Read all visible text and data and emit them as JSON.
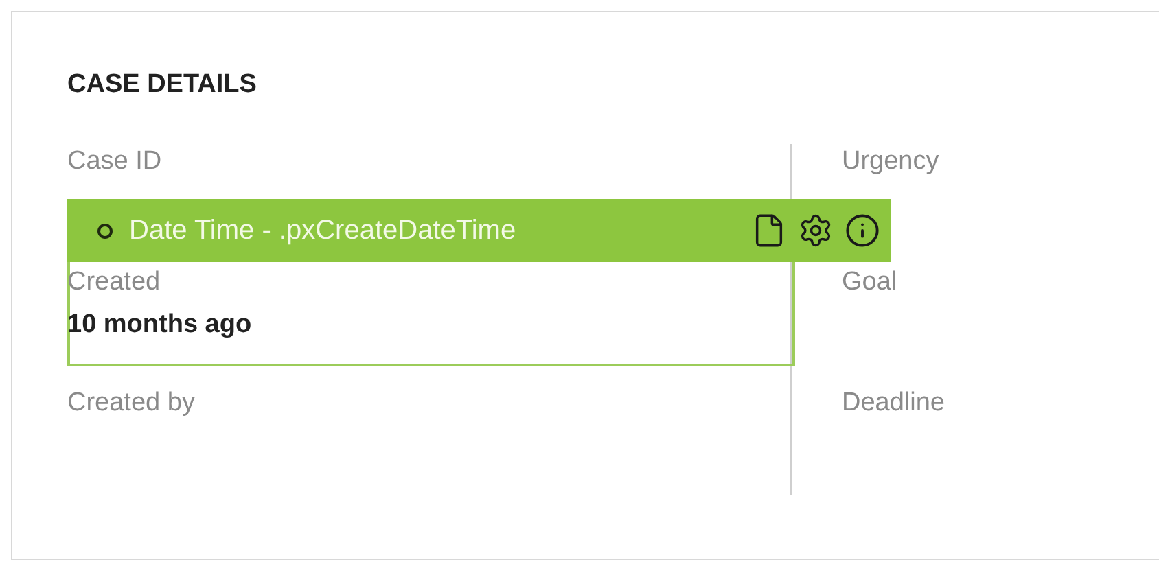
{
  "section": {
    "title": "CASE DETAILS"
  },
  "left_fields": [
    {
      "label": "Case ID",
      "selected": false
    },
    {
      "label": "Created",
      "value": "10 months ago",
      "selected": true
    },
    {
      "label": "Created by",
      "selected": false
    }
  ],
  "right_fields": [
    {
      "label": "Urgency"
    },
    {
      "label": "Goal"
    },
    {
      "label": "Deadline"
    }
  ],
  "inspector": {
    "label": "Date Time - .pxCreateDateTime"
  }
}
